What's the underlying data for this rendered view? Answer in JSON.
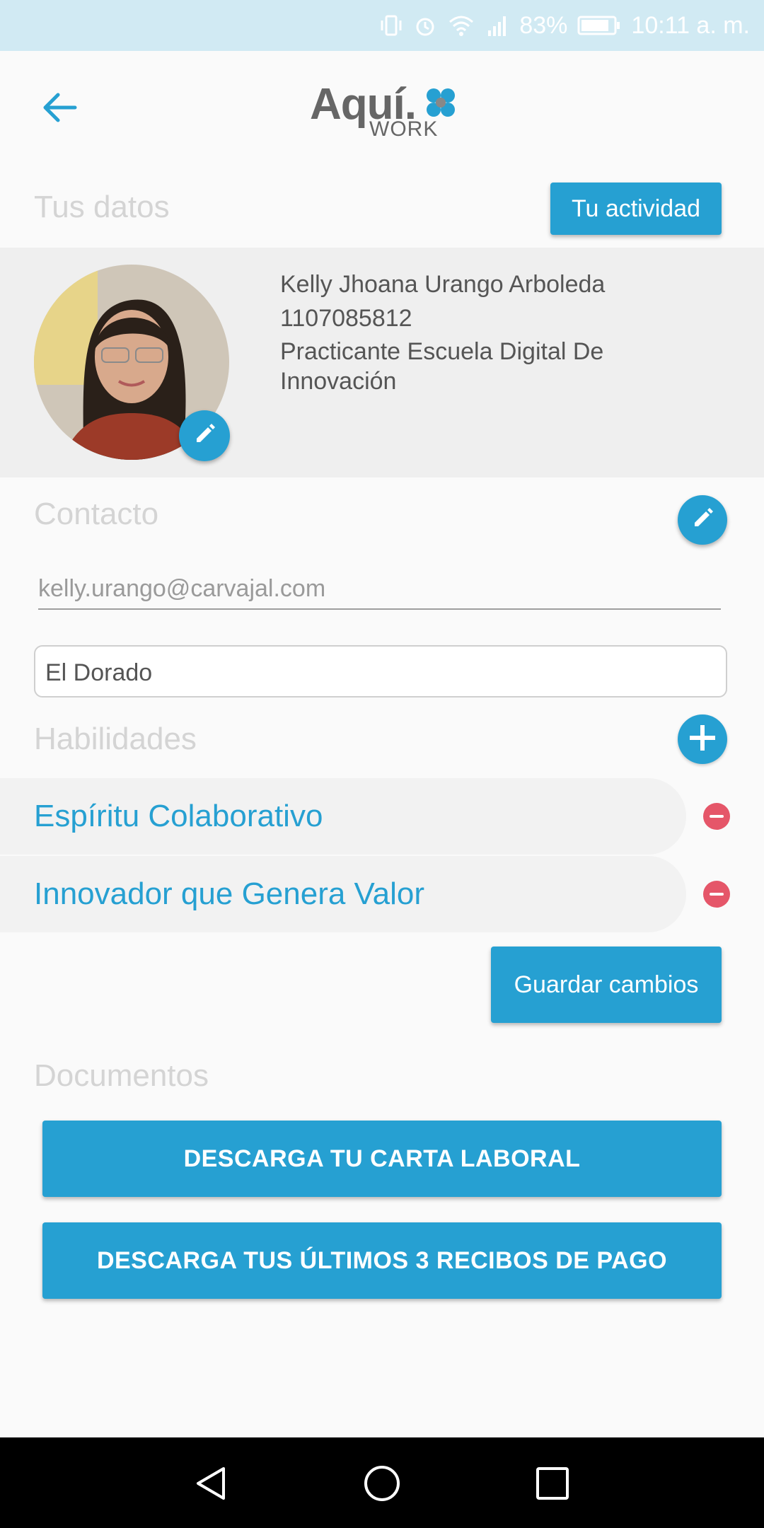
{
  "status_bar": {
    "battery": "83%",
    "time": "10:11 a. m.",
    "icons": [
      "vibrate-icon",
      "alarm-icon",
      "wifi-icon",
      "signal-icon",
      "battery-icon"
    ]
  },
  "header": {
    "back_icon": "arrow-left-icon",
    "logo_main": "Aquí.",
    "logo_sub": "WORK"
  },
  "profile": {
    "section_title": "Tus datos",
    "activity_button": "Tu actividad",
    "name": "Kelly Jhoana Urango Arboleda",
    "id_number": "1107085812",
    "job_title": "Practicante Escuela Digital De Innovación"
  },
  "contact": {
    "section_title": "Contacto",
    "email": "kelly.urango@carvajal.com",
    "location": "El Dorado"
  },
  "skills": {
    "section_title": "Habilidades",
    "items": [
      {
        "label": "Espíritu Colaborativo"
      },
      {
        "label": "Innovador que Genera Valor"
      }
    ],
    "save_button": "Guardar cambios"
  },
  "documents": {
    "section_title": "Documentos",
    "buttons": [
      {
        "label": "DESCARGA TU CARTA LABORAL"
      },
      {
        "label": "DESCARGA TUS ÚLTIMOS 3 RECIBOS DE PAGO"
      }
    ]
  },
  "navigation": {
    "icons": [
      "nav-back-icon",
      "nav-home-icon",
      "nav-recents-icon"
    ]
  },
  "colors": {
    "accent": "#26a0d2",
    "status_bar": "#d1eaf3",
    "remove": "#e55669"
  }
}
